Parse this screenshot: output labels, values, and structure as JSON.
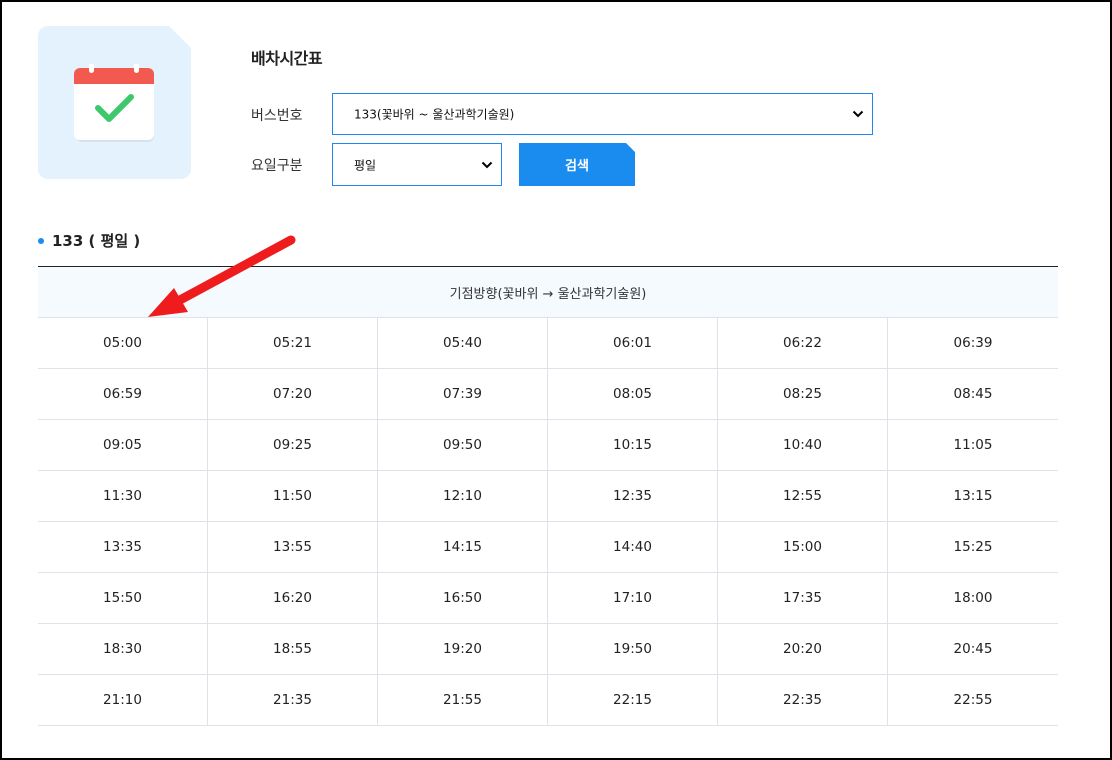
{
  "page": {
    "title": "배차시간표"
  },
  "form": {
    "bus_label": "버스번호",
    "bus_value": "133(꽃바위 ~ 울산과학기술원)",
    "day_label": "요일구분",
    "day_value": "평일",
    "search_label": "검색"
  },
  "result": {
    "heading": "133 ( 평일 )",
    "direction": "기점방향(꽃바위 → 울산과학기술원)",
    "rows": [
      [
        "05:00",
        "05:21",
        "05:40",
        "06:01",
        "06:22",
        "06:39"
      ],
      [
        "06:59",
        "07:20",
        "07:39",
        "08:05",
        "08:25",
        "08:45"
      ],
      [
        "09:05",
        "09:25",
        "09:50",
        "10:15",
        "10:40",
        "11:05"
      ],
      [
        "11:30",
        "11:50",
        "12:10",
        "12:35",
        "12:55",
        "13:15"
      ],
      [
        "13:35",
        "13:55",
        "14:15",
        "14:40",
        "15:00",
        "15:25"
      ],
      [
        "15:50",
        "16:20",
        "16:50",
        "17:10",
        "17:35",
        "18:00"
      ],
      [
        "18:30",
        "18:55",
        "19:20",
        "19:50",
        "20:20",
        "20:45"
      ],
      [
        "21:10",
        "21:35",
        "21:55",
        "22:15",
        "22:35",
        "22:55"
      ]
    ]
  },
  "colors": {
    "accent": "#1a8cf0",
    "annotation_arrow": "#ee1c1c",
    "calendar_header": "#f25a4f",
    "check": "#3dc86b"
  },
  "icons": {
    "hero": "calendar-check-icon",
    "select_arrow": "chevron-down-icon",
    "annotation": "red-arrow-icon"
  }
}
